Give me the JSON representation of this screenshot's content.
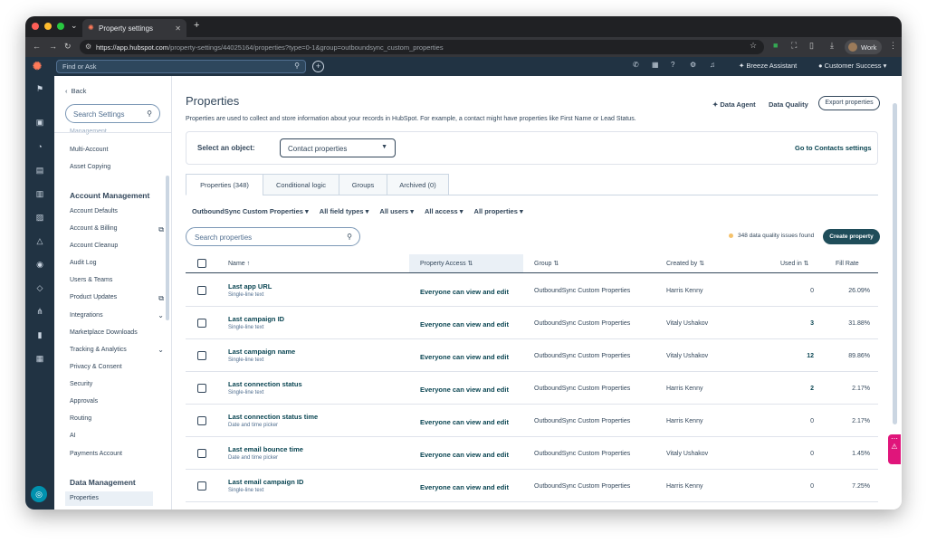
{
  "browser": {
    "tab_title": "Property settings",
    "url_host": "https://app.hubspot.com",
    "url_path": "/property-settings/44025164/properties?type=0-1&group=outboundsync_custom_properties",
    "profile": "Work"
  },
  "hubspot_nav": {
    "search_placeholder": "Find or Ask",
    "breeze": "Breeze Assistant",
    "account": "Customer Success"
  },
  "sidebar": {
    "back": "Back",
    "search_placeholder": "Search Settings",
    "partial_top": "Management",
    "items_top": [
      "Multi-Account",
      "Asset Copying"
    ],
    "section1": "Account Management",
    "items1": [
      "Account Defaults",
      "Account & Billing",
      "Account Cleanup",
      "Audit Log",
      "Users & Teams",
      "Product Updates",
      "Integrations",
      "Marketplace Downloads",
      "Tracking & Analytics",
      "Privacy & Consent",
      "Security",
      "Approvals",
      "Routing",
      "AI",
      "Payments Account"
    ],
    "section2": "Data Management",
    "items2": [
      "Properties"
    ]
  },
  "page": {
    "title": "Properties",
    "description": "Properties are used to collect and store information about your records in HubSpot. For example, a contact might have properties like First Name or Lead Status.",
    "data_agent": "Data Agent",
    "data_quality": "Data Quality",
    "export": "Export properties",
    "select_label": "Select an object:",
    "select_value": "Contact properties",
    "go_link": "Go to Contacts settings",
    "tabs": [
      "Properties (348)",
      "Conditional logic",
      "Groups",
      "Archived (0)"
    ],
    "filters": [
      "OutboundSync Custom Properties",
      "All field types",
      "All users",
      "All access",
      "All properties"
    ],
    "search_placeholder": "Search properties",
    "dq_text": "348 data quality issues found",
    "create": "Create property"
  },
  "table": {
    "headers": [
      "Name",
      "Property Access",
      "Group",
      "Created by",
      "Used in",
      "Fill Rate"
    ],
    "rows": [
      {
        "name": "Last app URL",
        "type": "Single-line text",
        "access": "Everyone can view and edit",
        "group": "OutboundSync Custom Properties",
        "created": "Harris Kenny",
        "used": "0",
        "fill": "26.09%"
      },
      {
        "name": "Last campaign ID",
        "type": "Single-line text",
        "access": "Everyone can view and edit",
        "group": "OutboundSync Custom Properties",
        "created": "Vitaly Ushakov",
        "used": "3",
        "fill": "31.88%"
      },
      {
        "name": "Last campaign name",
        "type": "Single-line text",
        "access": "Everyone can view and edit",
        "group": "OutboundSync Custom Properties",
        "created": "Vitaly Ushakov",
        "used": "12",
        "fill": "89.86%"
      },
      {
        "name": "Last connection status",
        "type": "Single-line text",
        "access": "Everyone can view and edit",
        "group": "OutboundSync Custom Properties",
        "created": "Harris Kenny",
        "used": "2",
        "fill": "2.17%"
      },
      {
        "name": "Last connection status time",
        "type": "Date and time picker",
        "access": "Everyone can view and edit",
        "group": "OutboundSync Custom Properties",
        "created": "Harris Kenny",
        "used": "0",
        "fill": "2.17%"
      },
      {
        "name": "Last email bounce time",
        "type": "Date and time picker",
        "access": "Everyone can view and edit",
        "group": "OutboundSync Custom Properties",
        "created": "Vitaly Ushakov",
        "used": "0",
        "fill": "1.45%"
      },
      {
        "name": "Last email campaign ID",
        "type": "Single-line text",
        "access": "Everyone can view and edit",
        "group": "OutboundSync Custom Properties",
        "created": "Harris Kenny",
        "used": "0",
        "fill": "7.25%"
      }
    ]
  }
}
